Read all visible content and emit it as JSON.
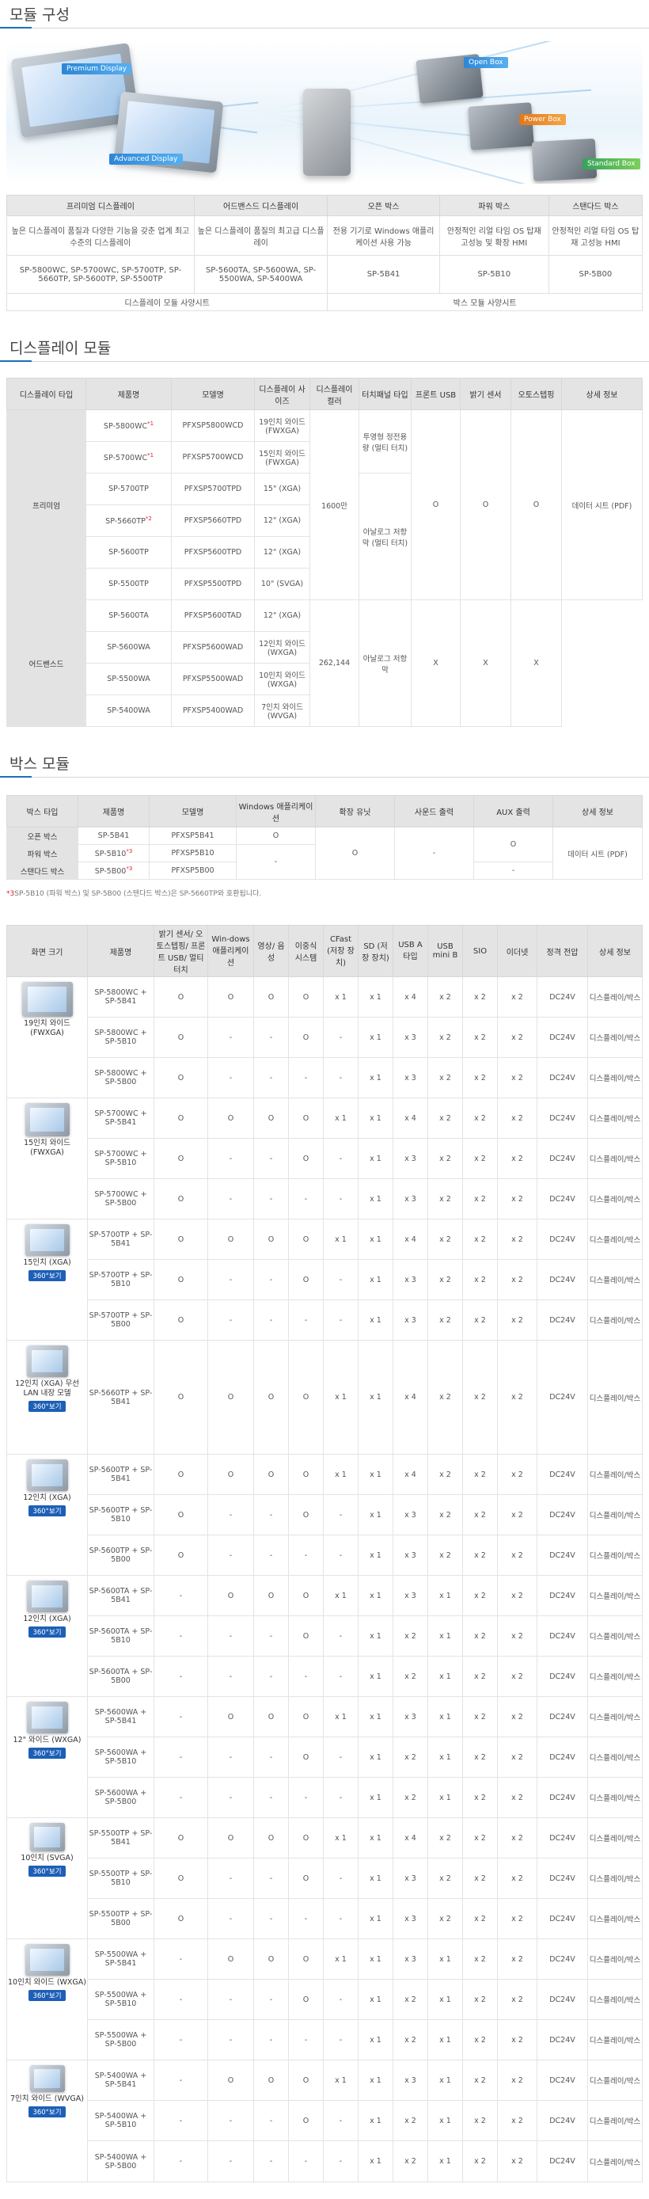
{
  "sections": {
    "module": "모듈 구성",
    "display": "디스플레이 모듈",
    "box": "박스 모듈"
  },
  "hero_tags": {
    "premium": "Premium Display",
    "advanced": "Advanced Display",
    "open": "Open Box",
    "power": "Power Box",
    "standard": "Standard Box"
  },
  "module_table": {
    "headers": [
      "프리미엄 디스플레이",
      "어드밴스드 디스플레이",
      "오픈 박스",
      "파워 박스",
      "스탠다드 박스"
    ],
    "desc": [
      "높은 디스플레이 품질과 다양한 기능을 갖춘 업계 최고 수준의 디스플레이",
      "높은 디스플레이 품질의 최고급 디스플레이",
      "전용 기기로 Windows 애플리케이션 사용 가능",
      "안정적인 리얼 타임 OS 탑재 고성능 및 확장 HMI",
      "안정적인 리얼 타임 OS 탑재 고성능 HMI"
    ],
    "models": [
      "SP-5800WC, SP-5700WC, SP-5700TP, SP-5660TP, SP-5600TP, SP-5500TP",
      "SP-5600TA, SP-5600WA, SP-5500WA, SP-5400WA",
      "SP-5B41",
      "SP-5B10",
      "SP-5B00"
    ],
    "spec_display": "디스플레이 모듈 사양시트",
    "spec_box": "박스 모듈 사양시트"
  },
  "display_table": {
    "headers": [
      "디스플레이 타입",
      "제품명",
      "모델명",
      "디스플레이 사이즈",
      "디스플레이 컬러",
      "터치패널 타입",
      "프론트 USB",
      "밝기 센서",
      "오토스텝핑",
      "상세 정보"
    ],
    "premium": "프리미엄",
    "advanced": "어드밴스드",
    "rows": [
      {
        "name": "SP-5800WC",
        "sup": "*1",
        "model": "PFXSP5800WCD",
        "size": "19인치 와이드 (FWXGA)"
      },
      {
        "name": "SP-5700WC",
        "sup": "*1",
        "model": "PFXSP5700WCD",
        "size": "15인치 와이드 (FWXGA)"
      },
      {
        "name": "SP-5700TP",
        "sup": "",
        "model": "PFXSP5700TPD",
        "size": "15\" (XGA)"
      },
      {
        "name": "SP-5660TP",
        "sup": "*2",
        "model": "PFXSP5660TPD",
        "size": "12\" (XGA)"
      },
      {
        "name": "SP-5600TP",
        "sup": "",
        "model": "PFXSP5600TPD",
        "size": "12\" (XGA)"
      },
      {
        "name": "SP-5500TP",
        "sup": "",
        "model": "PFXSP5500TPD",
        "size": "10\" (SVGA)"
      },
      {
        "name": "SP-5600TA",
        "sup": "",
        "model": "PFXSP5600TAD",
        "size": "12\" (XGA)"
      },
      {
        "name": "SP-5600WA",
        "sup": "",
        "model": "PFXSP5600WAD",
        "size": "12인치 와이드 (WXGA)"
      },
      {
        "name": "SP-5500WA",
        "sup": "",
        "model": "PFXSP5500WAD",
        "size": "10인치 와이드 (WXGA)"
      },
      {
        "name": "SP-5400WA",
        "sup": "",
        "model": "PFXSP5400WAD",
        "size": "7인치 와이드 (WVGA)"
      }
    ],
    "color_premium": "1600만",
    "color_advanced": "262,144",
    "touch_pcap": "투영형 정전용량 (멀티 터치)",
    "touch_analog": "아날로그 저항막 (멀티 터치)",
    "touch_analog2": "아날로그 저항막",
    "o": "O",
    "x": "X",
    "datasheet": "데이터 시트 (PDF)"
  },
  "box_table": {
    "headers": [
      "박스 타입",
      "제품명",
      "모델명",
      "Windows 애플리케이션",
      "확장 유닛",
      "사운드 출력",
      "AUX 출력",
      "상세 정보"
    ],
    "rows": [
      {
        "type": "오픈 박스",
        "name": "SP-5B41",
        "sup": "",
        "model": "PFXSP5B41",
        "win": "O",
        "aux": "O"
      },
      {
        "type": "파워 박스",
        "name": "SP-5B10",
        "sup": "*3",
        "model": "PFXSP5B10",
        "win": "-",
        "aux": "O"
      },
      {
        "type": "스탠다드 박스",
        "name": "SP-5B00",
        "sup": "*3",
        "model": "PFXSP5B00",
        "win": "",
        "aux": "-"
      }
    ],
    "expand": "O",
    "sound": "-",
    "datasheet": "데이터 시트 (PDF)",
    "note_mark": "*3",
    "note": "SP-5B10 (파워 박스) 및 SP-5B00 (스탠다드 박스)은 SP-5660TP와 호환됩니다."
  },
  "big_table": {
    "headers": [
      "화면 크기",
      "제품명",
      "밝기 센서/ 오토스텝핑/ 프론트 USB/ 멀티 터치",
      "Win-dows 애플리케이션",
      "영상/ 음성",
      "이중식 시스템",
      "CFast (저장 장치)",
      "SD (저장 장치)",
      "USB A타입",
      "USB mini B",
      "SIO",
      "이더넷",
      "정격 전압",
      "상세 정보"
    ],
    "btn360": "360°보기",
    "link": "디스플레이/박스",
    "groups": [
      {
        "label": "19인치 와이드 (FWXGA)",
        "btn": false,
        "rows": [
          [
            "SP-5800WC + SP-5B41",
            "O",
            "O",
            "O",
            "O",
            "x 1",
            "x 1",
            "x 4",
            "x 2",
            "x 2",
            "x 2",
            "DC24V"
          ],
          [
            "SP-5800WC + SP-5B10",
            "O",
            "-",
            "-",
            "O",
            "-",
            "x 1",
            "x 3",
            "x 2",
            "x 2",
            "x 2",
            "DC24V"
          ],
          [
            "SP-5800WC + SP-5B00",
            "O",
            "-",
            "-",
            "-",
            "-",
            "x 1",
            "x 3",
            "x 2",
            "x 2",
            "x 2",
            "DC24V"
          ]
        ]
      },
      {
        "label": "15인치 와이드 (FWXGA)",
        "btn": false,
        "rows": [
          [
            "SP-5700WC + SP-5B41",
            "O",
            "O",
            "O",
            "O",
            "x 1",
            "x 1",
            "x 4",
            "x 2",
            "x 2",
            "x 2",
            "DC24V"
          ],
          [
            "SP-5700WC + SP-5B10",
            "O",
            "-",
            "-",
            "O",
            "-",
            "x 1",
            "x 3",
            "x 2",
            "x 2",
            "x 2",
            "DC24V"
          ],
          [
            "SP-5700WC + SP-5B00",
            "O",
            "-",
            "-",
            "-",
            "-",
            "x 1",
            "x 3",
            "x 2",
            "x 2",
            "x 2",
            "DC24V"
          ]
        ]
      },
      {
        "label": "15인치 (XGA)",
        "btn": true,
        "rows": [
          [
            "SP-5700TP + SP-5B41",
            "O",
            "O",
            "O",
            "O",
            "x 1",
            "x 1",
            "x 4",
            "x 2",
            "x 2",
            "x 2",
            "DC24V"
          ],
          [
            "SP-5700TP + SP-5B10",
            "O",
            "-",
            "-",
            "O",
            "-",
            "x 1",
            "x 3",
            "x 2",
            "x 2",
            "x 2",
            "DC24V"
          ],
          [
            "SP-5700TP + SP-5B00",
            "O",
            "-",
            "-",
            "-",
            "-",
            "x 1",
            "x 3",
            "x 2",
            "x 2",
            "x 2",
            "DC24V"
          ]
        ]
      },
      {
        "label": "12인치 (XGA) 무선LAN 내장 모델",
        "btn": true,
        "rows": [
          [
            "SP-5660TP + SP-5B41",
            "O",
            "O",
            "O",
            "O",
            "x 1",
            "x 1",
            "x 4",
            "x 2",
            "x 2",
            "x 2",
            "DC24V"
          ]
        ]
      },
      {
        "label": "12인치 (XGA)",
        "btn": true,
        "rows": [
          [
            "SP-5600TP + SP-5B41",
            "O",
            "O",
            "O",
            "O",
            "x 1",
            "x 1",
            "x 4",
            "x 2",
            "x 2",
            "x 2",
            "DC24V"
          ],
          [
            "SP-5600TP + SP-5B10",
            "O",
            "-",
            "-",
            "O",
            "-",
            "x 1",
            "x 3",
            "x 2",
            "x 2",
            "x 2",
            "DC24V"
          ],
          [
            "SP-5600TP + SP-5B00",
            "O",
            "-",
            "-",
            "-",
            "-",
            "x 1",
            "x 3",
            "x 2",
            "x 2",
            "x 2",
            "DC24V"
          ]
        ]
      },
      {
        "label": "12인치 (XGA)",
        "btn": true,
        "rows": [
          [
            "SP-5600TA + SP-5B41",
            "-",
            "O",
            "O",
            "O",
            "x 1",
            "x 1",
            "x 3",
            "x 1",
            "x 2",
            "x 2",
            "DC24V"
          ],
          [
            "SP-5600TA + SP-5B10",
            "-",
            "-",
            "-",
            "O",
            "-",
            "x 1",
            "x 2",
            "x 1",
            "x 2",
            "x 2",
            "DC24V"
          ],
          [
            "SP-5600TA + SP-5B00",
            "-",
            "-",
            "-",
            "-",
            "-",
            "x 1",
            "x 2",
            "x 1",
            "x 2",
            "x 2",
            "DC24V"
          ]
        ]
      },
      {
        "label": "12\" 와이드 (WXGA)",
        "btn": true,
        "rows": [
          [
            "SP-5600WA + SP-5B41",
            "-",
            "O",
            "O",
            "O",
            "x 1",
            "x 1",
            "x 3",
            "x 1",
            "x 2",
            "x 2",
            "DC24V"
          ],
          [
            "SP-5600WA + SP-5B10",
            "-",
            "-",
            "-",
            "O",
            "-",
            "x 1",
            "x 2",
            "x 1",
            "x 2",
            "x 2",
            "DC24V"
          ],
          [
            "SP-5600WA + SP-5B00",
            "-",
            "-",
            "-",
            "-",
            "-",
            "x 1",
            "x 2",
            "x 1",
            "x 2",
            "x 2",
            "DC24V"
          ]
        ]
      },
      {
        "label": "10인치 (SVGA)",
        "btn": true,
        "rows": [
          [
            "SP-5500TP + SP-5B41",
            "O",
            "O",
            "O",
            "O",
            "x 1",
            "x 1",
            "x 4",
            "x 2",
            "x 2",
            "x 2",
            "DC24V"
          ],
          [
            "SP-5500TP + SP-5B10",
            "O",
            "-",
            "-",
            "O",
            "-",
            "x 1",
            "x 3",
            "x 2",
            "x 2",
            "x 2",
            "DC24V"
          ],
          [
            "SP-5500TP + SP-5B00",
            "O",
            "-",
            "-",
            "-",
            "-",
            "x 1",
            "x 3",
            "x 2",
            "x 2",
            "x 2",
            "DC24V"
          ]
        ]
      },
      {
        "label": "10인치 와이드 (WXGA)",
        "btn": true,
        "rows": [
          [
            "SP-5500WA + SP-5B41",
            "-",
            "O",
            "O",
            "O",
            "x 1",
            "x 1",
            "x 3",
            "x 1",
            "x 2",
            "x 2",
            "DC24V"
          ],
          [
            "SP-5500WA + SP-5B10",
            "-",
            "-",
            "-",
            "O",
            "-",
            "x 1",
            "x 2",
            "x 1",
            "x 2",
            "x 2",
            "DC24V"
          ],
          [
            "SP-5500WA + SP-5B00",
            "-",
            "-",
            "-",
            "-",
            "-",
            "x 1",
            "x 2",
            "x 1",
            "x 2",
            "x 2",
            "DC24V"
          ]
        ]
      },
      {
        "label": "7인치 와이드 (WVGA)",
        "btn": true,
        "rows": [
          [
            "SP-5400WA + SP-5B41",
            "-",
            "O",
            "O",
            "O",
            "x 1",
            "x 1",
            "x 3",
            "x 1",
            "x 2",
            "x 2",
            "DC24V"
          ],
          [
            "SP-5400WA + SP-5B10",
            "-",
            "-",
            "-",
            "O",
            "-",
            "x 1",
            "x 2",
            "x 1",
            "x 2",
            "x 2",
            "DC24V"
          ],
          [
            "SP-5400WA + SP-5B00",
            "-",
            "-",
            "-",
            "-",
            "-",
            "x 1",
            "x 2",
            "x 1",
            "x 2",
            "x 2",
            "DC24V"
          ]
        ]
      }
    ]
  }
}
